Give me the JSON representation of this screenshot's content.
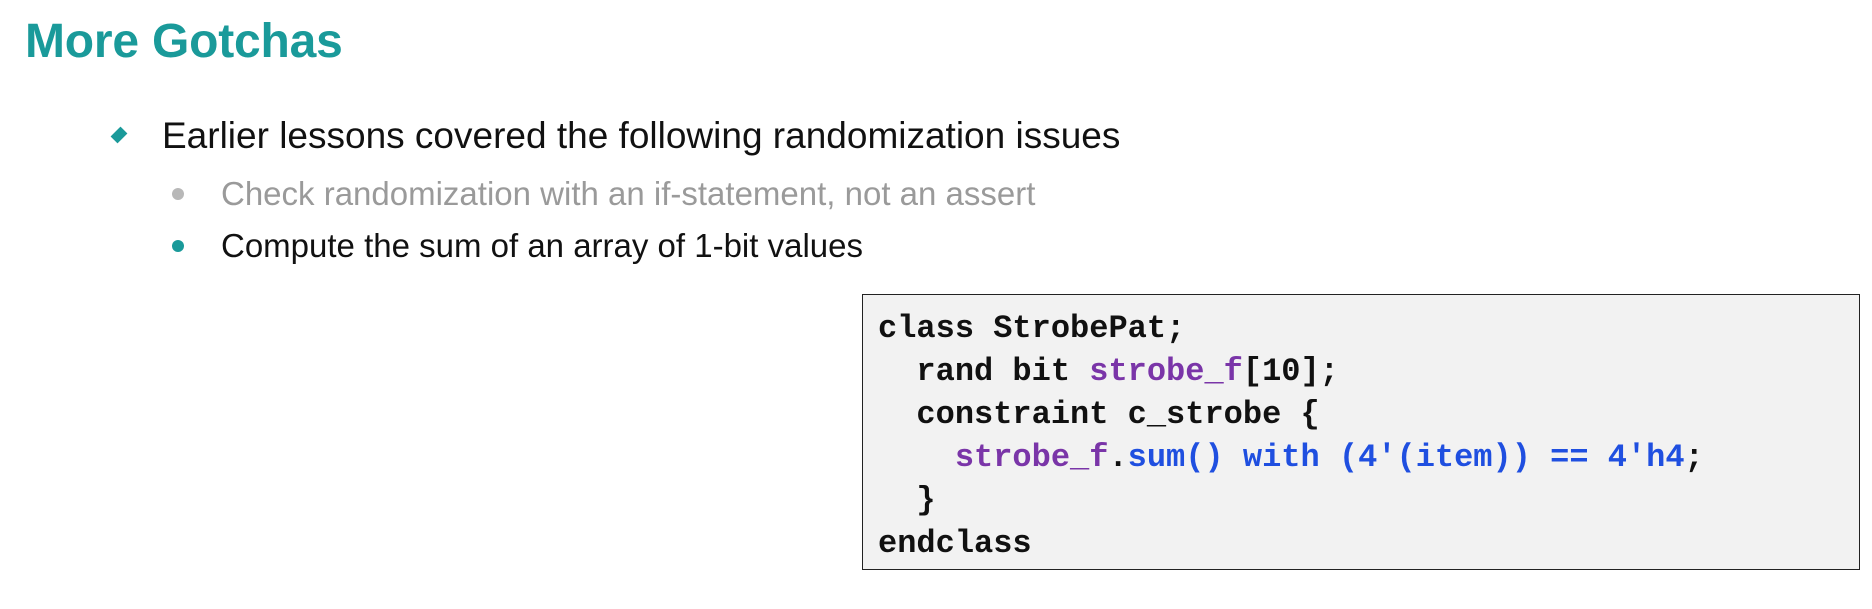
{
  "slide": {
    "title": "More Gotchas"
  },
  "bullets": {
    "level1": "Earlier lessons covered the following randomization issues",
    "level2": [
      "Check randomization with an if-statement, not an assert",
      "Compute the sum of an array of 1-bit values"
    ]
  },
  "code": {
    "line1": "class StrobePat;",
    "line2_a": "  rand bit ",
    "line2_b": "strobe_f",
    "line2_c": "[10];",
    "line3": "  constraint c_strobe {",
    "line4_indent": "    ",
    "line4_a": "strobe_f",
    "line4_b": ".",
    "line4_c": "sum() with (4'(item)) == 4'h4",
    "line4_d": ";",
    "line5": "  }",
    "line6": "endclass"
  },
  "colors": {
    "title": "#1a9a9a",
    "accent_bullet": "#1a9a9a",
    "dim_text": "#9a9a9a",
    "code_purple": "#7a35a8",
    "code_blue": "#1f4fe0",
    "code_bg": "#f2f2f2"
  },
  "icons": {
    "level1_bullet": "diamond-bullet-icon",
    "level2_bullet": "dot-bullet-icon"
  }
}
